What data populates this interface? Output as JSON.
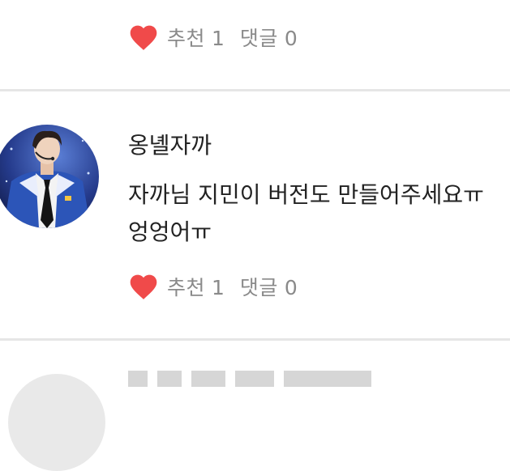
{
  "previous_comment": {
    "reactions": {
      "like_label": "추천",
      "like_count": "1",
      "reply_label": "댓글",
      "reply_count": "0"
    }
  },
  "comment": {
    "username": "옹녤자까",
    "text": "자까님 지민이 버전도 만들어주세요ㅠ 엉엉어ㅠ",
    "reactions": {
      "like_label": "추천",
      "like_count": "1",
      "reply_label": "댓글",
      "reply_count": "0"
    }
  },
  "icons": {
    "like": "heart-icon"
  },
  "colors": {
    "heart": "#f04a4a",
    "reaction_text": "#8a8a8a",
    "divider": "#e6e6e6"
  }
}
